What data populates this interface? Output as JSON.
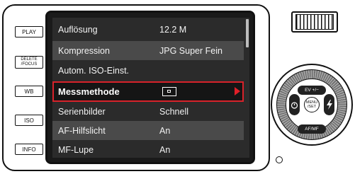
{
  "side_buttons": [
    {
      "label": "PLAY"
    },
    {
      "label": "DELETE\n/FOCUS"
    },
    {
      "label": "WB"
    },
    {
      "label": "ISO"
    },
    {
      "label": "INFO"
    }
  ],
  "menu": {
    "items": [
      {
        "label": "Auflösung",
        "value": "12.2 M"
      },
      {
        "label": "Kompression",
        "value": "JPG Super Fein"
      },
      {
        "label": "Autom. ISO-Einst.",
        "value": ""
      },
      {
        "label": "Messmethode",
        "value_icon": "spot-metering-icon",
        "selected": true
      },
      {
        "label": "Serienbilder",
        "value": "Schnell"
      },
      {
        "label": "AF-Hilfslicht",
        "value": "An"
      },
      {
        "label": "MF-Lupe",
        "value": "An"
      }
    ]
  },
  "dial": {
    "top_label": "EV +/−",
    "bottom_label": "AF/MF",
    "center_label": "MENU\n/SET",
    "left_icon": "self-timer-icon",
    "right_icon": "flash-icon"
  },
  "colors": {
    "selection_border": "#d8222a",
    "selection_arrow": "#e01f28",
    "lcd_background": "#2b2b2b",
    "row_alternate": "#4a4a4a"
  }
}
